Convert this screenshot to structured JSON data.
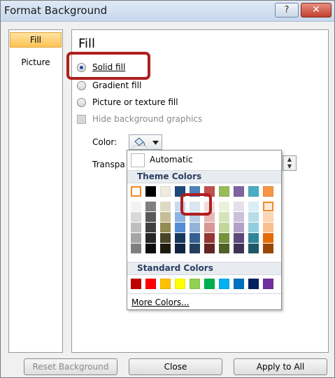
{
  "window": {
    "title": "Format Background",
    "help_glyph": "?",
    "close_glyph": "✕"
  },
  "nav": {
    "items": [
      {
        "label": "Fill"
      },
      {
        "label": "Picture"
      }
    ]
  },
  "fill": {
    "heading": "Fill",
    "options": [
      {
        "label": "Solid fill",
        "selected": true
      },
      {
        "label": "Gradient fill",
        "selected": false
      },
      {
        "label": "Picture or texture fill",
        "selected": false
      }
    ],
    "hide_bg_label": "Hide background graphics",
    "color_label": "Color:",
    "transparency_label": "Transpa"
  },
  "color_menu": {
    "automatic_label": "Automatic",
    "theme_header": "Theme Colors",
    "standard_header": "Standard Colors",
    "more_colors_label": "More Colors...",
    "theme_row": [
      "#ffffff",
      "#000000",
      "#eeece1",
      "#1f497d",
      "#4f81bd",
      "#c0504d",
      "#9bbb59",
      "#8064a2",
      "#4bacc6",
      "#f79646"
    ],
    "tint_columns": [
      [
        "#f2f2f2",
        "#d9d9d9",
        "#bfbfbf",
        "#a6a6a6",
        "#7f7f7f"
      ],
      [
        "#7f7f7f",
        "#595959",
        "#404040",
        "#262626",
        "#0d0d0d"
      ],
      [
        "#ddd9c3",
        "#c4bd97",
        "#948a54",
        "#4a452a",
        "#1d1b10"
      ],
      [
        "#c6d9f0",
        "#8db3e2",
        "#548dd4",
        "#17365d",
        "#0f243e"
      ],
      [
        "#dbe5f1",
        "#b8cce4",
        "#95b3d7",
        "#366092",
        "#244061"
      ],
      [
        "#f2dcdb",
        "#e5b9b7",
        "#d99694",
        "#953734",
        "#632423"
      ],
      [
        "#ebf1dd",
        "#d7e3bc",
        "#c3d69b",
        "#76923c",
        "#4f6128"
      ],
      [
        "#e5e0ec",
        "#ccc1d9",
        "#b2a2c7",
        "#5f497a",
        "#3f3151"
      ],
      [
        "#dbeef3",
        "#b7dde8",
        "#92cddc",
        "#31859b",
        "#205867"
      ],
      [
        "#fdeada",
        "#fbd5b5",
        "#fac08f",
        "#e36c09",
        "#974806"
      ]
    ],
    "standard_row": [
      "#c00000",
      "#ff0000",
      "#ffc000",
      "#ffff00",
      "#92d050",
      "#00b050",
      "#00b0f0",
      "#0070c0",
      "#002060",
      "#7030a0"
    ]
  },
  "buttons": {
    "reset_label": "Reset Background",
    "close_label": "Close",
    "apply_label": "Apply to All"
  }
}
